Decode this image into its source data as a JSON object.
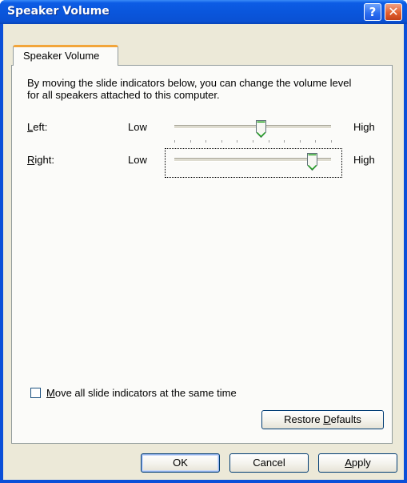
{
  "window": {
    "title": "Speaker Volume",
    "help_glyph": "?",
    "close_glyph": "✕"
  },
  "tabs": [
    {
      "label": "Speaker Volume"
    }
  ],
  "description": "By moving the slide indicators below, you can change the volume level for all speakers attached to this computer.",
  "channels": [
    {
      "label_accel": "L",
      "label_rest": "eft:",
      "low": "Low",
      "high": "High",
      "level_percent": 55
    },
    {
      "label_accel": "R",
      "label_rest": "ight:",
      "low": "Low",
      "high": "High",
      "level_percent": 88
    }
  ],
  "move_all": {
    "accel": "M",
    "rest": "ove all slide indicators at the same time",
    "checked": false
  },
  "buttons": {
    "restore_pre": "Restore ",
    "restore_accel": "D",
    "restore_post": "efaults",
    "ok": "OK",
    "cancel": "Cancel",
    "apply_accel": "A",
    "apply_rest": "pply"
  },
  "colors": {
    "titlebar": "#0a56dc",
    "dialog_face": "#ece9d8",
    "tab_highlight": "#f2a53a",
    "slider_thumb_accent": "#21a121"
  }
}
